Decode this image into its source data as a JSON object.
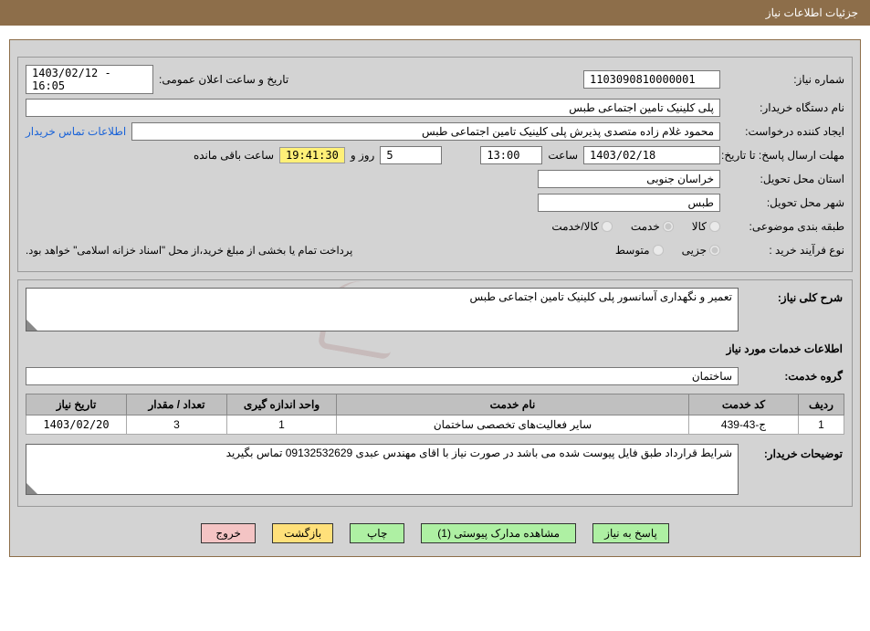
{
  "title": "جزئیات اطلاعات نیاز",
  "labels": {
    "needNo": "شماره نیاز:",
    "announceDate": "تاریخ و ساعت اعلان عمومی:",
    "buyerOrg": "نام دستگاه خریدار:",
    "creator": "ایجاد کننده درخواست:",
    "contactLink": "اطلاعات تماس خریدار",
    "deadline": "مهلت ارسال پاسخ: تا تاریخ:",
    "hour": "ساعت",
    "daysAnd": "روز و",
    "remaining": "ساعت باقی مانده",
    "province": "استان محل تحویل:",
    "city": "شهر محل تحویل:",
    "classify": "طبقه بندی موضوعی:",
    "classGoods": "کالا",
    "classService": "خدمت",
    "classBoth": "کالا/خدمت",
    "procType": "نوع فرآیند خرید :",
    "procSmall": "جزیی",
    "procMedium": "متوسط",
    "paymentNote": "پرداخت تمام یا بخشی از مبلغ خرید،از محل \"اسناد خزانه اسلامی\" خواهد بود.",
    "needDescHeader": "شرح کلی نیاز:",
    "servicesHeader": "اطلاعات خدمات مورد نیاز",
    "serviceGroup": "گروه خدمت:",
    "buyerRemarks": "توضیحات خریدار:",
    "thRow": "ردیف",
    "thCode": "کد خدمت",
    "thName": "نام خدمت",
    "thUnit": "واحد اندازه گیری",
    "thQty": "تعداد / مقدار",
    "thDate": "تاریخ نیاز"
  },
  "values": {
    "needNo": "1103090810000001",
    "announceDate": "1403/02/12 - 16:05",
    "buyerOrg": "پلی کلینیک تامین اجتماعی طبس",
    "creator": "محمود غلام زاده  متصدی پذیرش پلی کلینیک تامین اجتماعی طبس",
    "deadlineDate": "1403/02/18",
    "deadlineHour": "13:00",
    "remainingDays": "5",
    "countdown": "19:41:30",
    "province": "خراسان جنوبی",
    "city": "طبس",
    "needDesc": "تعمیر و نگهداری آسانسور پلی کلینیک تامین اجتماعی طبس",
    "serviceGroup": "ساختمان",
    "buyerRemarks": "شرایط قرارداد طبق فایل پیوست شده می باشد در صورت نیاز با اقای مهندس عبدی 09132532629 تماس بگیرید"
  },
  "table": [
    {
      "row": "1",
      "code": "ج-43-439",
      "name": "سایر فعالیت‌های تخصصی ساختمان",
      "unit": "1",
      "qty": "3",
      "date": "1403/02/20"
    }
  ],
  "buttons": {
    "reply": "پاسخ به نیاز",
    "attachments": "مشاهده مدارک پیوستی (1)",
    "print": "چاپ",
    "back": "بازگشت",
    "exit": "خروج"
  },
  "watermark": "ArtaTender.net"
}
